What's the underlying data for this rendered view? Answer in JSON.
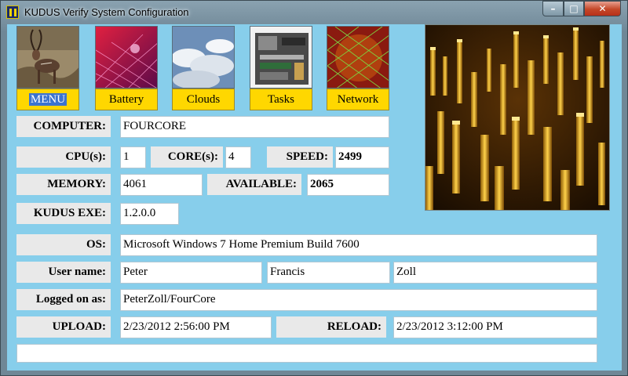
{
  "window": {
    "title": "KUDUS Verify System Configuration",
    "controls": {
      "minimize": "–",
      "maximize": "□",
      "close": "✕"
    }
  },
  "tiles": [
    {
      "label": "MENU"
    },
    {
      "label": "Battery"
    },
    {
      "label": "Clouds"
    },
    {
      "label": "Tasks"
    },
    {
      "label": "Network"
    }
  ],
  "fields": {
    "computer_label": "COMPUTER:",
    "computer_value": "FOURCORE",
    "cpu_label": "CPU(s):",
    "cpu_value": "1",
    "core_label": "CORE(s):",
    "core_value": "4",
    "speed_label": "SPEED:",
    "speed_value": "2499",
    "memory_label": "MEMORY:",
    "memory_value": "4061",
    "available_label": "AVAILABLE:",
    "available_value": "2065",
    "exe_label": "KUDUS EXE:",
    "exe_value": "1.2.0.0",
    "os_label": "OS:",
    "os_value": "Microsoft Windows 7 Home Premium  Build 7600",
    "username_label": "User name:",
    "username_first": "Peter",
    "username_middle": "Francis",
    "username_last": "Zoll",
    "logged_label": "Logged on as:",
    "logged_value": "PeterZoll/FourCore",
    "upload_label": "UPLOAD:",
    "upload_value": "2/23/2012 2:56:00 PM",
    "reload_label": "RELOAD:",
    "reload_value": "2/23/2012 3:12:00 PM",
    "status_value": ""
  },
  "colors": {
    "client_bg": "#87ceeb",
    "button_yellow": "#ffd700",
    "label_gray": "#e9e9e9"
  }
}
